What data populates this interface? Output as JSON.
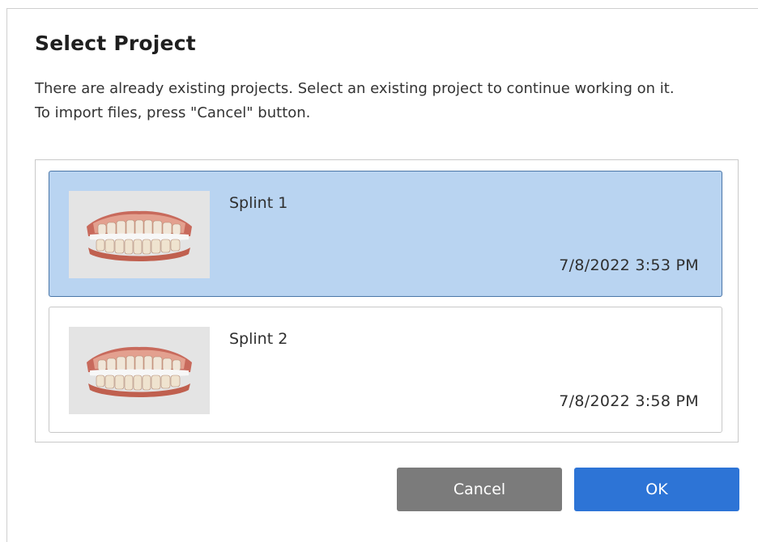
{
  "dialog": {
    "title": "Select Project",
    "description_line1": "There are already existing projects. Select an existing project to continue working on it.",
    "description_line2": "To import files, press \"Cancel\" button."
  },
  "projects": [
    {
      "name": "Splint 1",
      "date": "7/8/2022 3:53 PM",
      "selected": true,
      "thumbnail_icon": "dental-model-icon"
    },
    {
      "name": "Splint 2",
      "date": "7/8/2022 3:58 PM",
      "selected": false,
      "thumbnail_icon": "dental-model-icon"
    }
  ],
  "buttons": {
    "cancel_label": "Cancel",
    "ok_label": "OK"
  },
  "colors": {
    "selected_background": "#b9d4f1",
    "selected_border": "#4a76a8",
    "ok_button": "#2d74d6",
    "cancel_button": "#7b7b7b"
  }
}
